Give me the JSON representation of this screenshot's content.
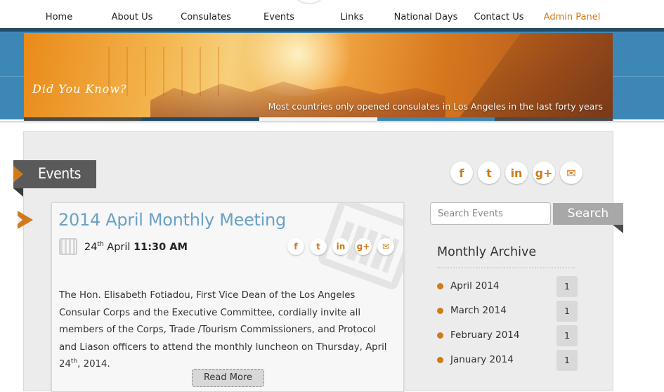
{
  "nav": {
    "items": [
      {
        "label": "Home"
      },
      {
        "label": "About Us"
      },
      {
        "label": "Consulates"
      },
      {
        "label": "Events"
      },
      {
        "label": "Links"
      },
      {
        "label": "National Days"
      },
      {
        "label": "Contact Us"
      },
      {
        "label": "Admin Panel"
      }
    ]
  },
  "banner": {
    "heading": "Did You Know?",
    "caption": "Most countries only opened consulates in Los Angeles in the last forty years"
  },
  "slider": {
    "tab_colors": [
      "#4b4b4b",
      "#1f4a63",
      "#f2f2f2",
      "#3d87b7",
      "#4b4b4b"
    ]
  },
  "page": {
    "section_title": "Events"
  },
  "share": {
    "icons": [
      "facebook-icon",
      "twitter-icon",
      "linkedin-icon",
      "google-plus-icon",
      "email-icon"
    ],
    "glyphs": [
      "f",
      "t",
      "in",
      "g+",
      "✉"
    ]
  },
  "event": {
    "title": "2014 April Monthly Meeting",
    "date_day": "24",
    "date_suffix": "th",
    "date_month": " April ",
    "time": "11:30 AM",
    "body_part1": "The Hon. Elisabeth Fotiadou, First Vice Dean of the Los Angeles Consular Corps and the Executive Committee, cordially invite all members of the Corps, Trade /Tourism Commissioners, and Protocol and Liason officers to attend the monthly luncheon on Thursday, April 24",
    "body_sup": "th",
    "body_part2": ", 2014.",
    "read_more": "Read More"
  },
  "sidebar": {
    "search_placeholder": "Search Events",
    "search_button": "Search",
    "archive_title": "Monthly Archive",
    "archive": [
      {
        "label": "April 2014",
        "count": "1"
      },
      {
        "label": "March 2014",
        "count": "1"
      },
      {
        "label": "February 2014",
        "count": "1"
      },
      {
        "label": "January 2014",
        "count": "1"
      }
    ]
  },
  "colors": {
    "accent": "#d07a1a",
    "title_blue": "#6aa2c5",
    "nav_dark": "#234b63",
    "banner_blue": "#3d87b7"
  }
}
